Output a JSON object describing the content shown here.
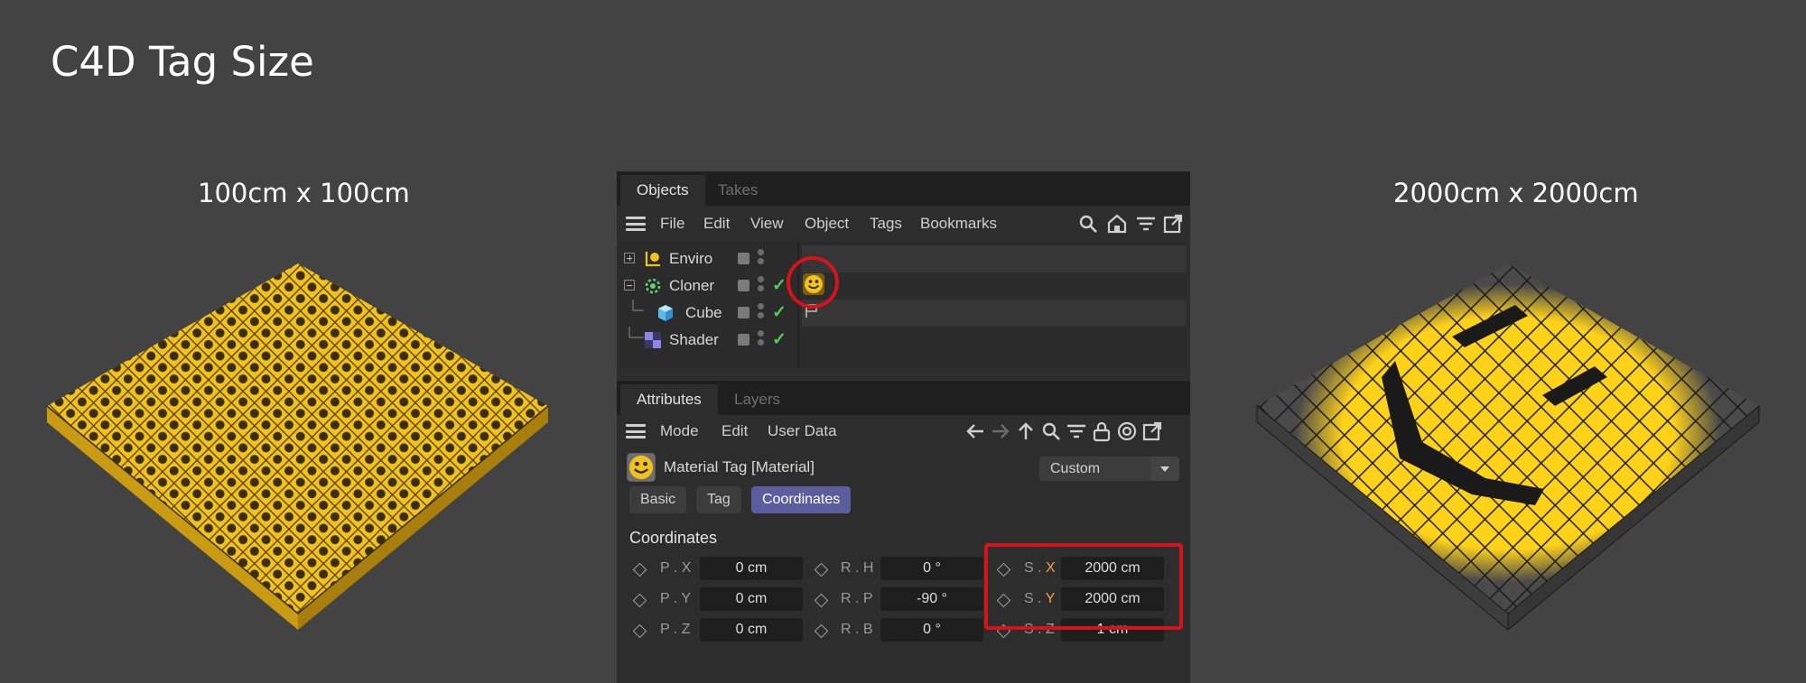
{
  "title": "C4D Tag Size",
  "captions": {
    "left": "100cm x 100cm",
    "right": "2000cm x 2000cm"
  },
  "objects_panel": {
    "tabs": [
      "Objects",
      "Takes"
    ],
    "menu": [
      "File",
      "Edit",
      "View",
      "Object",
      "Tags",
      "Bookmarks"
    ],
    "tree": [
      {
        "name": "Enviro"
      },
      {
        "name": "Cloner"
      },
      {
        "name": "Cube"
      },
      {
        "name": "Shader"
      }
    ]
  },
  "attributes_panel": {
    "tabs": [
      "Attributes",
      "Layers"
    ],
    "menu": [
      "Mode",
      "Edit",
      "User Data"
    ],
    "material_tag": "Material Tag [Material]",
    "projection": "Custom",
    "sub_tabs": [
      "Basic",
      "Tag",
      "Coordinates"
    ],
    "section": "Coordinates",
    "fields": {
      "px": {
        "label": "P . X",
        "value": "0 cm"
      },
      "py": {
        "label": "P . Y",
        "value": "0 cm"
      },
      "pz": {
        "label": "P . Z",
        "value": "0 cm"
      },
      "rh": {
        "label": "R . H",
        "value": "0 °"
      },
      "rp": {
        "label": "R . P",
        "value": "-90 °"
      },
      "rb": {
        "label": "R . B",
        "value": "0 °"
      },
      "sx": {
        "label": "S . ",
        "axis": "X",
        "value": "2000 cm"
      },
      "sy": {
        "label": "S . ",
        "axis": "Y",
        "value": "2000 cm"
      },
      "sz": {
        "label": "S . Z",
        "value": "1 cm"
      }
    }
  },
  "colors": {
    "highlight": "#d6121b",
    "active_tab": "#5a5e9c",
    "yellow": "#f2c21b",
    "check": "#4fcc52"
  }
}
